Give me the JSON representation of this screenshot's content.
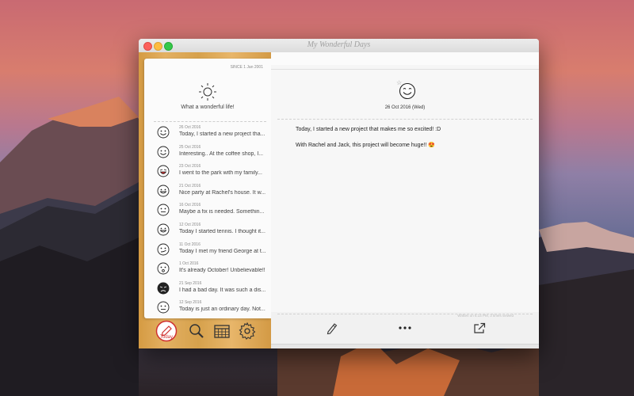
{
  "window": {
    "title": "My Wonderful Days"
  },
  "journal": {
    "since": "SINCE 1 Jan 2001",
    "motto": "What a wonderful life!",
    "entries": [
      {
        "date": "26 Oct 2016",
        "snippet": "Today, I started a new project tha...",
        "mood": "happy-face-icon"
      },
      {
        "date": "25 Oct 2016",
        "snippet": "Interesting.. At the coffee shop, I...",
        "mood": "smile-face-icon"
      },
      {
        "date": "23 Oct 2016",
        "snippet": "I went to the park with my family...",
        "mood": "laughing-face-icon"
      },
      {
        "date": "21 Oct 2016",
        "snippet": "Nice party at Rachel's house. It w...",
        "mood": "grin-face-icon"
      },
      {
        "date": "16 Oct 2016",
        "snippet": "Maybe a fix is needed. Somethin...",
        "mood": "neutral-face-icon"
      },
      {
        "date": "12 Oct 2016",
        "snippet": "Today I started tennis. I thought it...",
        "mood": "grin-face-icon"
      },
      {
        "date": "11 Oct 2016",
        "snippet": "Today I met my friend George at t...",
        "mood": "smirk-face-icon"
      },
      {
        "date": "1 Oct 2016",
        "snippet": "It's already October! Unbelievable!!",
        "mood": "surprised-face-icon"
      },
      {
        "date": "21 Sep 2016",
        "snippet": "I had a bad day. It was such a dis...",
        "mood": "sad-face-icon"
      },
      {
        "date": "12 Sep 2016",
        "snippet": "Today is just an ordinary day. Not...",
        "mood": "neutral-face-icon"
      }
    ]
  },
  "toolbar": {
    "today_label": "Today",
    "icons": [
      "today-pencil-icon",
      "search-icon",
      "calendar-icon",
      "gear-icon"
    ]
  },
  "detail": {
    "date": "26 Oct 2016 (Wed)",
    "paragraphs": [
      "Today, I started a new project that makes me so excited! :D",
      "With Rachel and Jack, this project will become huge!! 😍"
    ],
    "meta": "Written on 6:14 PM, 3 times viewed",
    "actions": [
      "edit-pencil-icon",
      "more-icon",
      "share-icon"
    ]
  },
  "colors": {
    "wood": "#d59b43",
    "accent": "#d03030",
    "ink": "#333333"
  }
}
